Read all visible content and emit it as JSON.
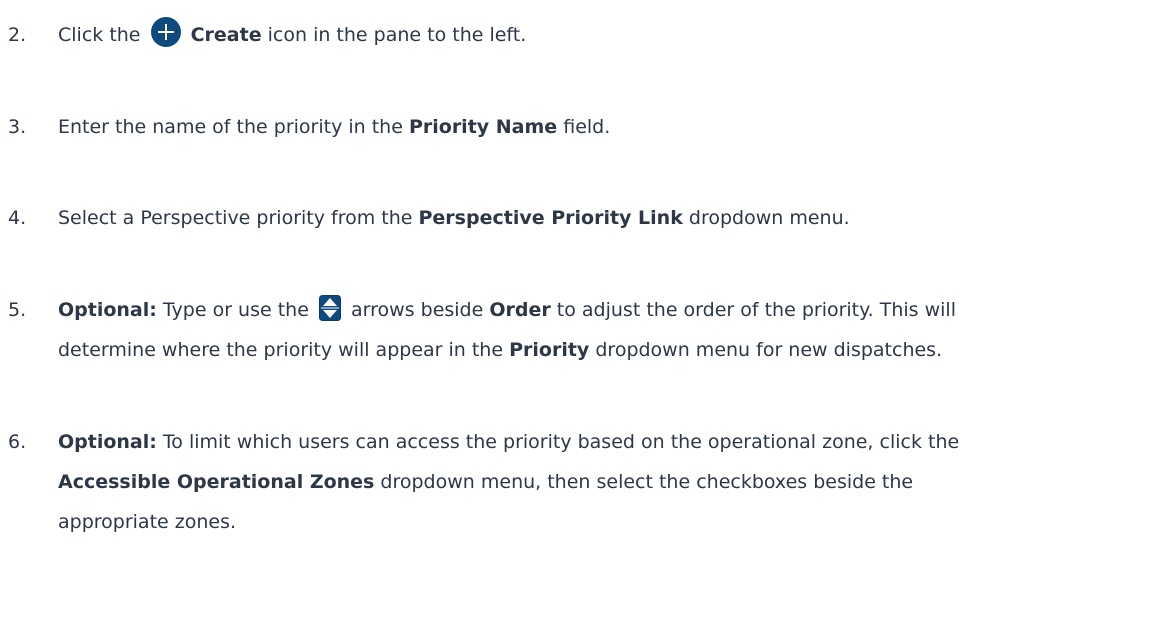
{
  "steps": [
    {
      "number": "2.",
      "t1": "Click the",
      "b1": "Create",
      "t2": "icon in the pane to the left.",
      "icon": "create-plus-icon"
    },
    {
      "number": "3.",
      "t1": "Enter the name of the priority in the",
      "b1": "Priority Name",
      "t2": "field."
    },
    {
      "number": "4.",
      "t1": "Select a Perspective priority from the",
      "b1": "Perspective Priority Link",
      "t2": "dropdown menu."
    },
    {
      "number": "5.",
      "b0": "Optional:",
      "t1": "Type or use the",
      "icon": "up-down-arrows-icon",
      "t2": "arrows beside",
      "b1": "Order",
      "t3": "to adjust the order of the priority. This will",
      "l2_t1": "determine where the priority will appear in the",
      "l2_b1": "Priority",
      "l2_t2": "dropdown menu for new dispatches."
    },
    {
      "number": "6.",
      "b0": "Optional:",
      "t1": "To limit which users can access the priority based on the operational zone, click the",
      "l2_b1": "Accessible Operational Zones",
      "l2_t1": "dropdown menu, then select the checkboxes beside the",
      "l3_t1": "appropriate zones."
    }
  ],
  "colors": {
    "text": "#2d3748",
    "icon_blue": "#0e4a7e"
  }
}
